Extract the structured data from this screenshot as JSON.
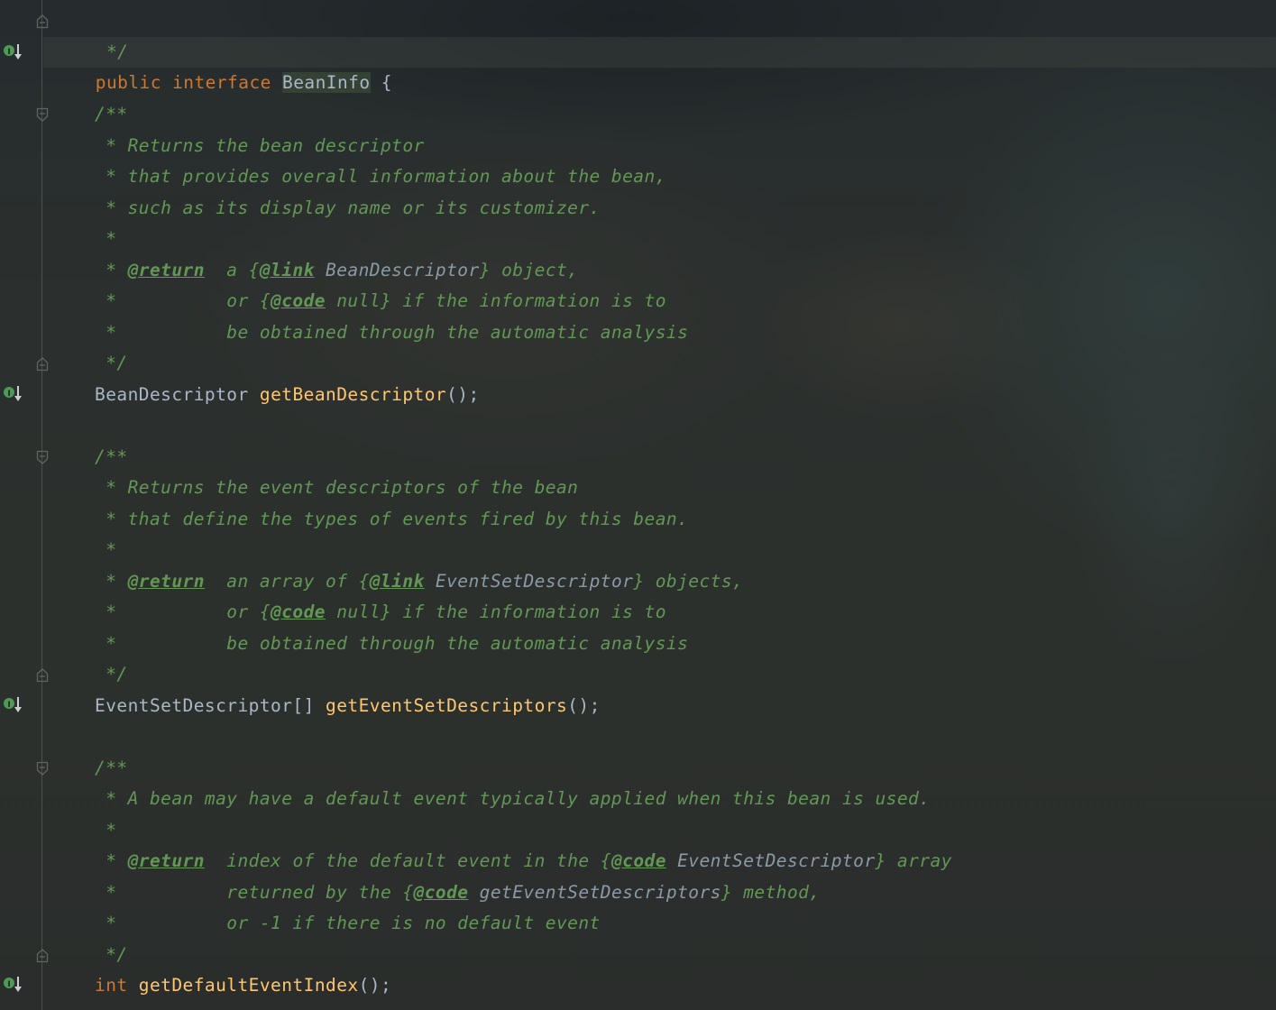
{
  "editor": {
    "lines": {
      "l0": {
        "close": " */"
      },
      "l1": {
        "kw_public": "public",
        "kw_interface": "interface",
        "name": "BeanInfo",
        "brace": "{"
      },
      "c1": {
        "open": "/**",
        "t1": " * Returns the bean descriptor",
        "t2": " * that provides overall information about the bean,",
        "t3": " * such as its display name or its customizer.",
        "t4": " *",
        "t5a": " * ",
        "t5tag": "@return",
        "t5b": "  a {",
        "t5link": "@link",
        "t5ref": " BeanDescriptor",
        "t5c": "} object,",
        "t6a": " *          or {",
        "t6code": "@code",
        "t6b": " null} if the information is to",
        "t7": " *          be obtained through the automatic analysis",
        "close": " */"
      },
      "m1": {
        "type": "BeanDescriptor",
        "method": "getBeanDescriptor",
        "tail": "();"
      },
      "c2": {
        "open": "/**",
        "t1": " * Returns the event descriptors of the bean",
        "t2": " * that define the types of events fired by this bean.",
        "t3": " *",
        "t4a": " * ",
        "t4tag": "@return",
        "t4b": "  an array of {",
        "t4link": "@link",
        "t4ref": " EventSetDescriptor",
        "t4c": "} objects,",
        "t5a": " *          or {",
        "t5code": "@code",
        "t5b": " null} if the information is to",
        "t6": " *          be obtained through the automatic analysis",
        "close": " */"
      },
      "m2": {
        "type": "EventSetDescriptor[]",
        "method": "getEventSetDescriptors",
        "tail": "();"
      },
      "c3": {
        "open": "/**",
        "t1": " * A bean may have a default event typically applied when this bean is used.",
        "t2": " *",
        "t3a": " * ",
        "t3tag": "@return",
        "t3b": "  index of the default event in the {",
        "t3code": "@code",
        "t3ref": " EventSetDescriptor",
        "t3c": "} array",
        "t4a": " *          returned by the {",
        "t4code": "@code",
        "t4ref": " getEventSetDescriptors",
        "t4c": "} method,",
        "t5": " *          or -1 if there is no default event",
        "close": " */"
      },
      "m3": {
        "type": "int",
        "method": "getDefaultEventIndex",
        "tail": "();"
      }
    }
  },
  "colors": {
    "keyword": "#cc7832",
    "method": "#ffc66d",
    "identifier": "#a9b7c6",
    "doc_comment": "#629755",
    "gutter_marker": "#4e9a56"
  },
  "icons": {
    "gutter_marker": "implemented-method-icon",
    "fold_marker": "fold-icon"
  }
}
